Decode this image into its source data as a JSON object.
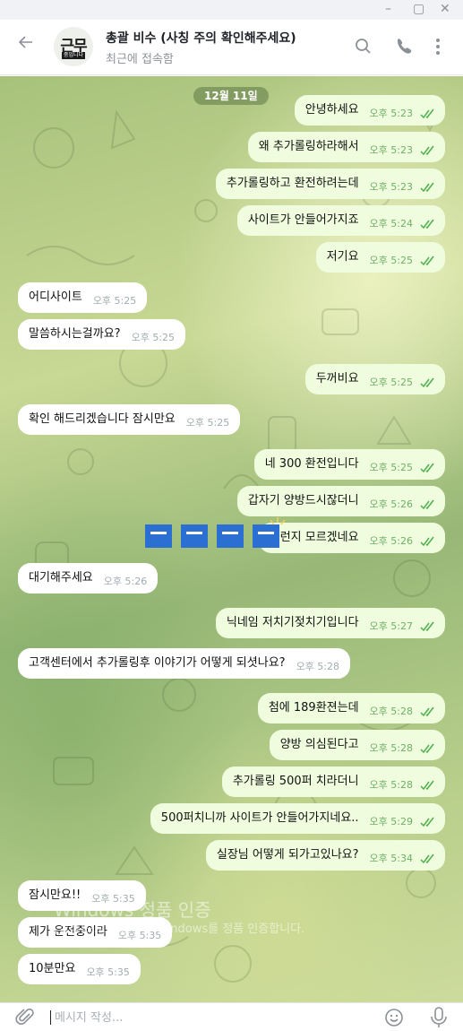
{
  "window": {
    "minimize": "–",
    "maximize": "▢",
    "close": "✕"
  },
  "header": {
    "back_icon": "arrow-left-icon",
    "avatar_text_top": "근무",
    "avatar_text_bottom": "중입니다",
    "title": "총괄 비수 (사칭 주의 확인해주세요)",
    "status": "최근에 접속함",
    "icons": [
      "search-icon",
      "phone-icon",
      "more-vertical-icon"
    ]
  },
  "chat": {
    "date_label": "12월 11일",
    "messages": [
      {
        "dir": "out",
        "text": "안녕하세요",
        "time": "오후 5:23"
      },
      {
        "dir": "out",
        "text": "왜 추가롤링하라해서",
        "time": "오후 5:23"
      },
      {
        "dir": "out",
        "text": "추가롤링하고 환전하려는데",
        "time": "오후 5:23"
      },
      {
        "dir": "out",
        "text": "사이트가 안들어가지죠",
        "time": "오후 5:24"
      },
      {
        "dir": "out",
        "text": "저기요",
        "time": "오후 5:25"
      },
      {
        "dir": "in",
        "text": "어디사이트",
        "time": "오후 5:25"
      },
      {
        "dir": "in",
        "text": "말씀하시는걸까요?",
        "time": "오후 5:25"
      },
      {
        "dir": "out",
        "text": "두꺼비요",
        "time": "오후 5:25"
      },
      {
        "dir": "in",
        "text": "확인 해드리겠습니다 잠시만요",
        "time": "오후 5:25"
      },
      {
        "dir": "out",
        "text": "네 300 환전입니다",
        "time": "오후 5:25"
      },
      {
        "dir": "out",
        "text": "갑자기 양방드시잖더니",
        "time": "오후 5:26"
      },
      {
        "dir": "out",
        "text": "그런지 모르겠네요",
        "time": "오후 5:26"
      },
      {
        "dir": "in",
        "text": "대기해주세요",
        "time": "오후 5:26"
      },
      {
        "dir": "out",
        "text": "닉네임 저치기젖치기입니다",
        "time": "오후 5:27"
      },
      {
        "dir": "in",
        "text": "고객센터에서 추가롤링후 이야기가 어떻게 되셧나요?",
        "time": "오후 5:28"
      },
      {
        "dir": "out",
        "text": "첨에 189환젼는데",
        "time": "오후 5:28"
      },
      {
        "dir": "out",
        "text": "양방 의심된다고",
        "time": "오후 5:28"
      },
      {
        "dir": "out",
        "text": "추가롤링 500퍼 치라더니",
        "time": "오후 5:28"
      },
      {
        "dir": "out",
        "text": "500퍼치니까 사이트가 안들어가지네요..",
        "time": "오후 5:29"
      },
      {
        "dir": "out",
        "text": "실장님 어떻게 되가고있나요?",
        "time": "오후 5:34"
      },
      {
        "dir": "in",
        "text": "잠시만요!!",
        "time": "오후 5:35"
      },
      {
        "dir": "in",
        "text": "제가 운전중이라",
        "time": "오후 5:35"
      },
      {
        "dir": "in",
        "text": "10분만요",
        "time": "오후 5:35"
      }
    ]
  },
  "overlay": {
    "windows_line1": "Windows 정품 인증",
    "windows_line2": "[설정]으로 이동하여 Windows를 정품 인증합니다."
  },
  "composer": {
    "placeholder": "메시지 작성...",
    "icons": [
      "paperclip-icon",
      "smile-icon",
      "microphone-icon"
    ]
  },
  "colors": {
    "outgoing_bubble": "#effdde",
    "incoming_bubble": "#ffffff",
    "read_tick": "#4fae4e",
    "watermark_blue": "#2a6fd1"
  }
}
